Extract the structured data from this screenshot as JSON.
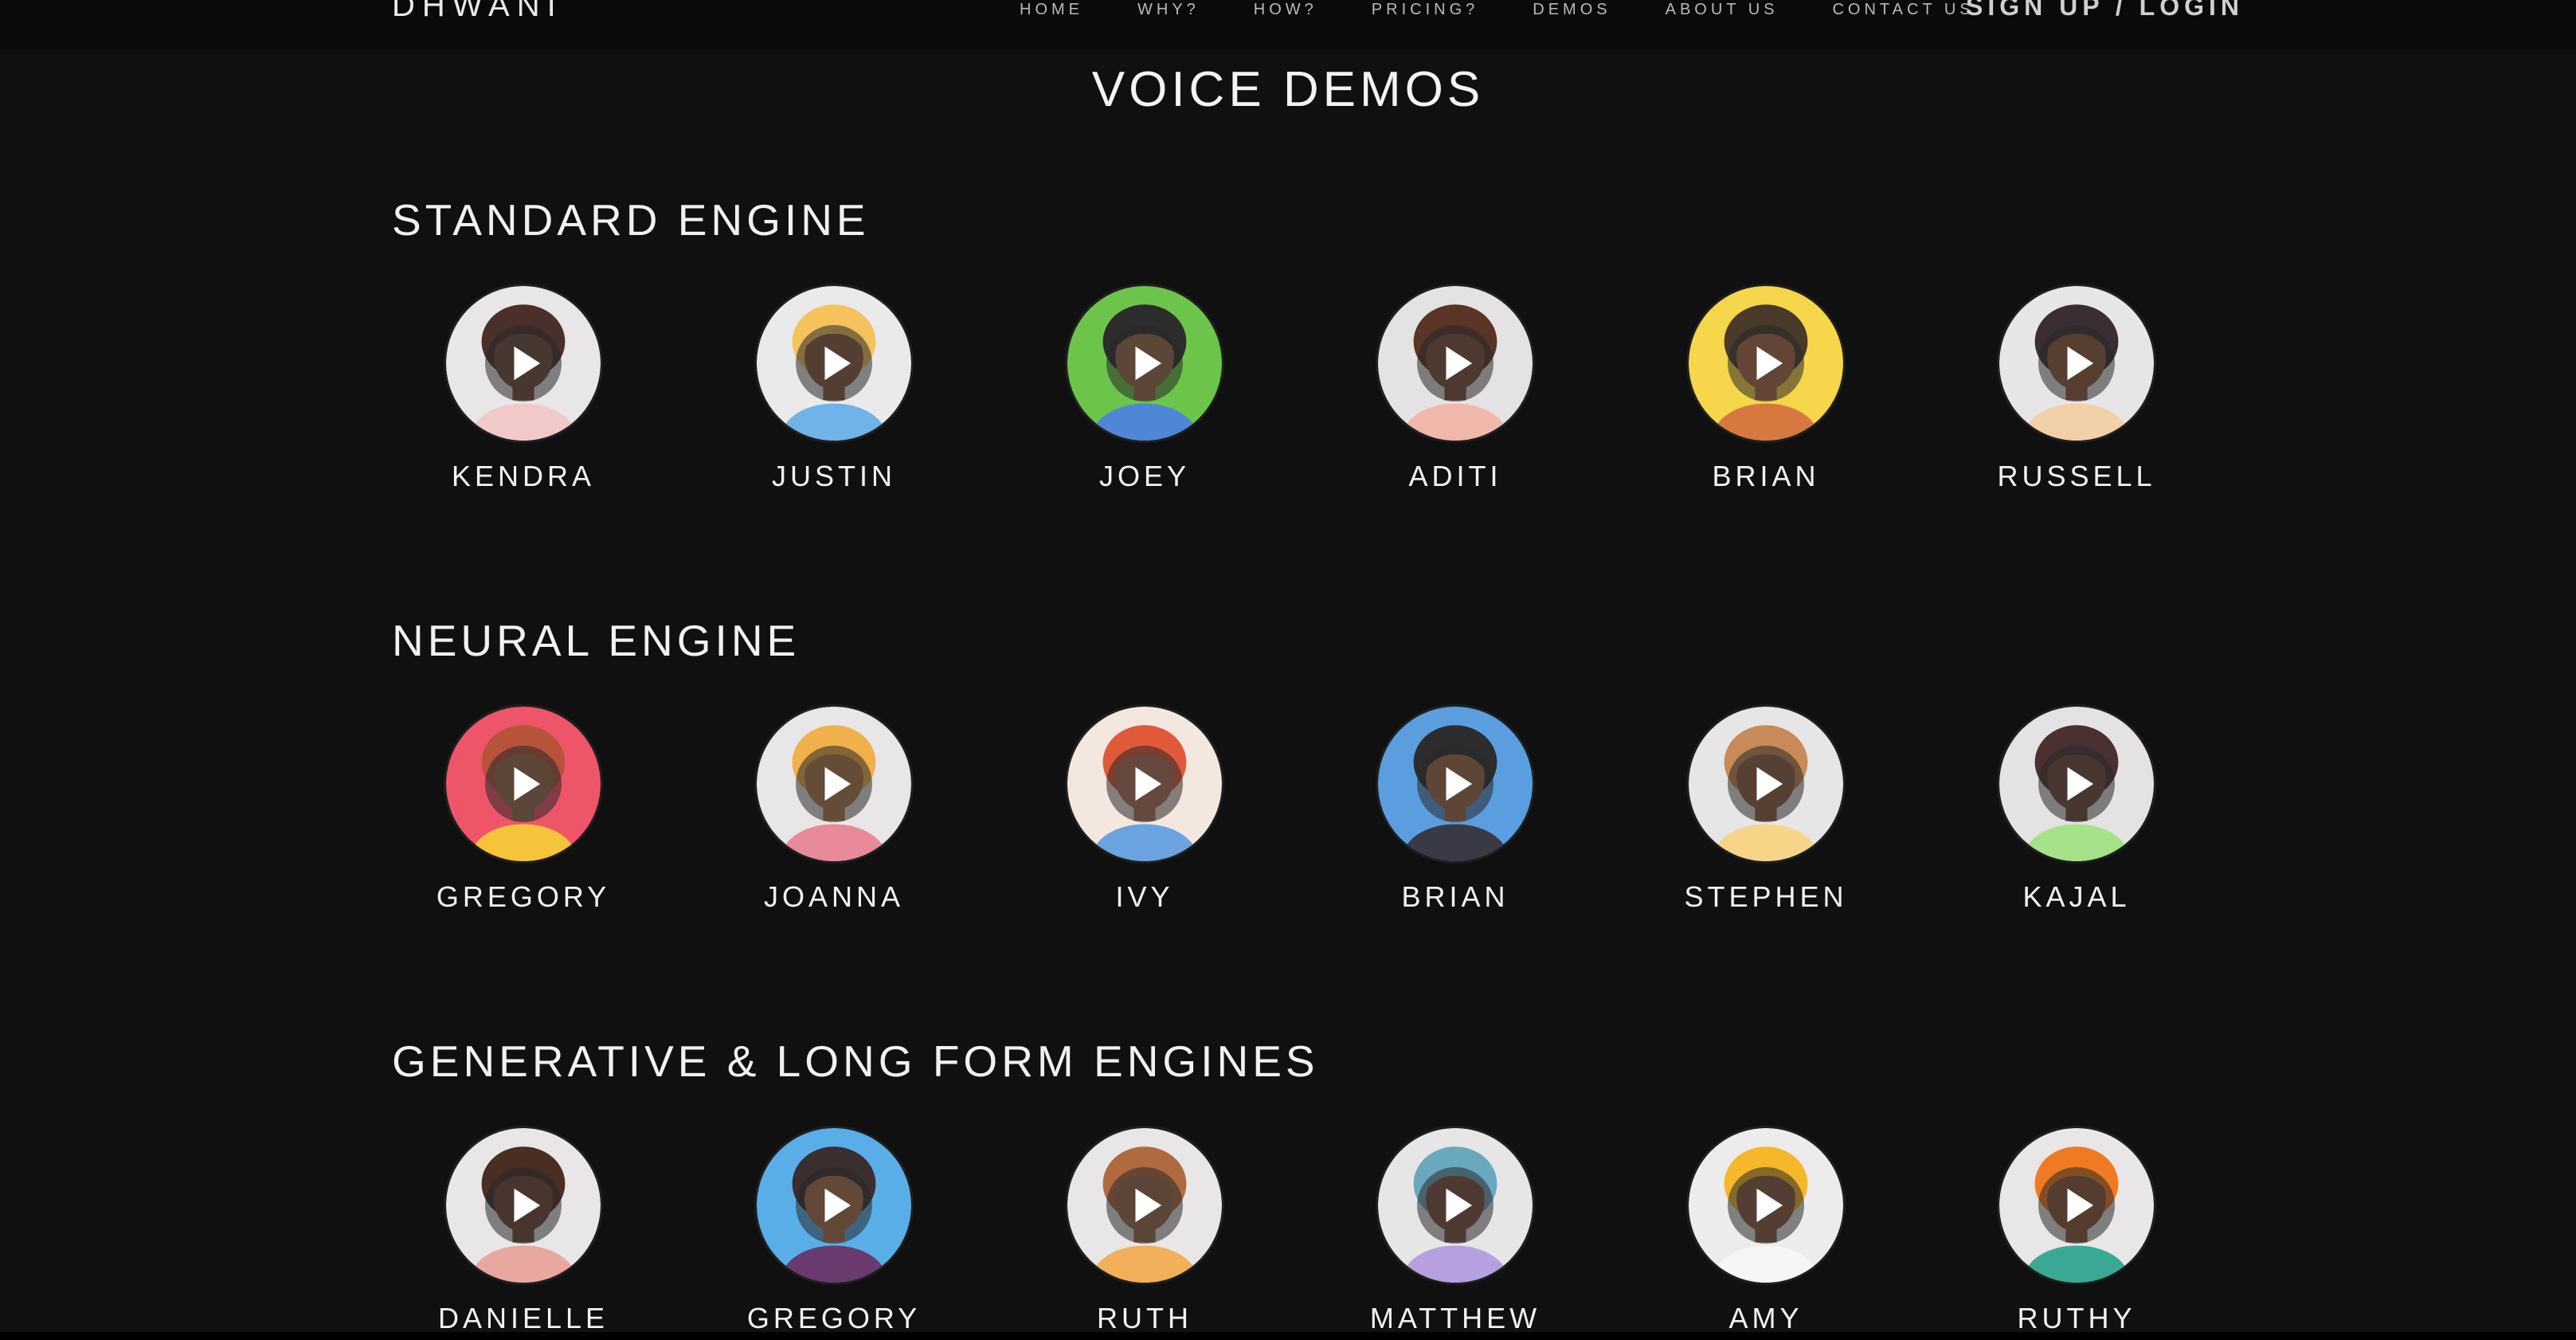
{
  "nav": {
    "brand": "DHWANI",
    "links": [
      "HOME",
      "WHY?",
      "HOW?",
      "PRICING?",
      "DEMOS",
      "ABOUT US",
      "CONTACT US"
    ],
    "login": "SIGN UP / LOGIN"
  },
  "page": {
    "title": "VOICE DEMOS"
  },
  "sections": [
    {
      "title": "STANDARD ENGINE",
      "voices": [
        {
          "name": "KENDRA",
          "bg": "#e8e6e6",
          "skin": "#6b4a3c",
          "hair": "#4a2f2a",
          "shirt": "#f1c9c9"
        },
        {
          "name": "JUSTIN",
          "bg": "#eaeaea",
          "skin": "#8a5a3e",
          "hair": "#f4c35b",
          "shirt": "#6fb3e8"
        },
        {
          "name": "JOEY",
          "bg": "#6cc54a",
          "skin": "#9a6a4a",
          "hair": "#2d2d2d",
          "shirt": "#4f87d6"
        },
        {
          "name": "ADITI",
          "bg": "#e4e2e2",
          "skin": "#7a4e3a",
          "hair": "#5a3425",
          "shirt": "#f0b8a8"
        },
        {
          "name": "BRIAN",
          "bg": "#f6d64a",
          "skin": "#a8684a",
          "hair": "#4a3a2a",
          "shirt": "#d77840"
        },
        {
          "name": "RUSSELL",
          "bg": "#e6e6e6",
          "skin": "#8e5a3d",
          "hair": "#3a2d34",
          "shirt": "#f2d0a8"
        }
      ]
    },
    {
      "title": "NEURAL ENGINE",
      "voices": [
        {
          "name": "GREGORY",
          "bg": "#ee5568",
          "skin": "#9a6a4a",
          "hair": "#b7533a",
          "shirt": "#f5c43c"
        },
        {
          "name": "JOANNA",
          "bg": "#e8e6e6",
          "skin": "#b07848",
          "hair": "#f0b04a",
          "shirt": "#e88a9a"
        },
        {
          "name": "IVY",
          "bg": "#f3e7e0",
          "skin": "#b0705a",
          "hair": "#e05a3a",
          "shirt": "#6aa3e0"
        },
        {
          "name": "BRIAN",
          "bg": "#5b9ee0",
          "skin": "#a06a4a",
          "hair": "#2d2d2d",
          "shirt": "#3a3a46"
        },
        {
          "name": "STEPHEN",
          "bg": "#e6e6e6",
          "skin": "#8e5c40",
          "hair": "#c98a5a",
          "shirt": "#f6d488"
        },
        {
          "name": "KAJAL",
          "bg": "#e4e2e2",
          "skin": "#6e4a3a",
          "hair": "#4a3030",
          "shirt": "#a6e28a"
        }
      ]
    },
    {
      "title": "GENERATIVE & LONG FORM ENGINES",
      "voices": [
        {
          "name": "DANIELLE",
          "bg": "#e8e6e6",
          "skin": "#6e4636",
          "hair": "#4a2e24",
          "shirt": "#e8a8a0"
        },
        {
          "name": "GREGORY",
          "bg": "#5aaee8",
          "skin": "#a8704a",
          "hair": "#3a2e2e",
          "shirt": "#6a3a6e"
        },
        {
          "name": "RUTH",
          "bg": "#e8e6e6",
          "skin": "#9a6848",
          "hair": "#b06a40",
          "shirt": "#f2b05a"
        },
        {
          "name": "MATTHEW",
          "bg": "#e6e6e6",
          "skin": "#7e5040",
          "hair": "#6aa8c0",
          "shirt": "#b6a0e0"
        },
        {
          "name": "AMY",
          "bg": "#ececec",
          "skin": "#8a5a40",
          "hair": "#f4b82a",
          "shirt": "#f6f6f6"
        },
        {
          "name": "RUTHY",
          "bg": "#e8e6e6",
          "skin": "#8a5438",
          "hair": "#f07a22",
          "shirt": "#3aa894"
        }
      ]
    }
  ]
}
